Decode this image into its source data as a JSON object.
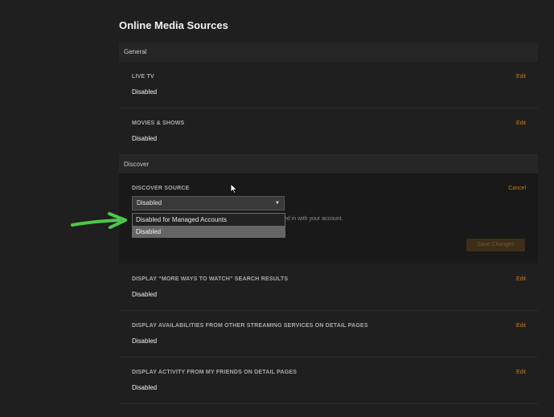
{
  "page": {
    "title": "Online Media Sources"
  },
  "sections": {
    "general": "General",
    "discover": "Discover"
  },
  "rows": {
    "live_tv": {
      "label": "LIVE TV",
      "value": "Disabled",
      "action": "Edit"
    },
    "movies_shows": {
      "label": "MOVIES & SHOWS",
      "value": "Disabled",
      "action": "Edit"
    },
    "discover_source": {
      "label": "DISCOVER SOURCE",
      "action": "Cancel",
      "selected": "Disabled",
      "help_text": "ed in with your account.",
      "save_label": "Save Changes",
      "options": [
        "Disabled for Managed Accounts",
        "Disabled"
      ]
    },
    "more_ways": {
      "label": "DISPLAY “MORE WAYS TO WATCH” SEARCH RESULTS",
      "value": "Disabled",
      "action": "Edit"
    },
    "availabilities": {
      "label": "DISPLAY AVAILABILITIES FROM OTHER STREAMING SERVICES ON DETAIL PAGES",
      "value": "Disabled",
      "action": "Edit"
    },
    "friends_activity": {
      "label": "DISPLAY ACTIVITY FROM MY FRIENDS ON DETAIL PAGES",
      "value": "Disabled",
      "action": "Edit"
    }
  },
  "colors": {
    "background": "#1f1f1f",
    "accent": "#cc7b19",
    "annotation_arrow": "#4cc84a"
  },
  "icons": {
    "dropdown_arrow": "caret-down-icon",
    "pointer": "mouse-cursor-icon",
    "annotation": "green-arrow-icon"
  }
}
